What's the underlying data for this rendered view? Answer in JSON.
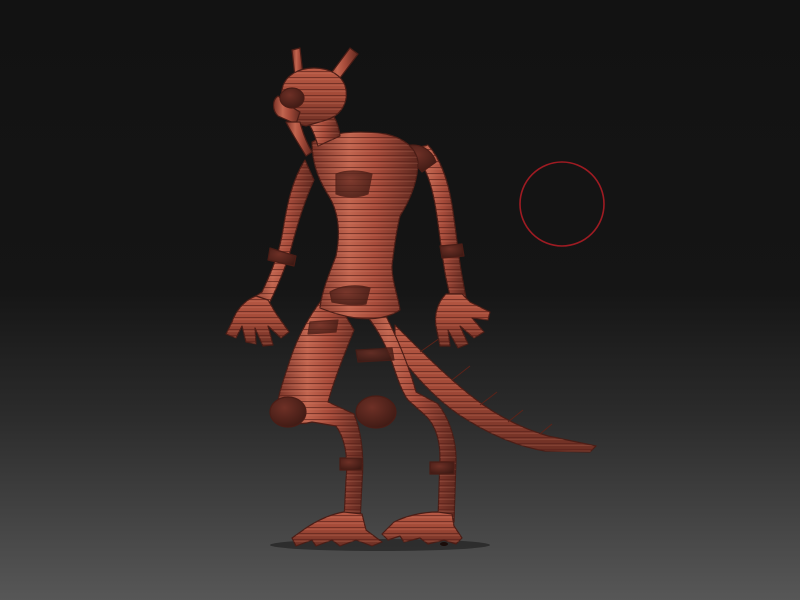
{
  "viewport": {
    "background_top": "#141414",
    "background_bottom": "#565656",
    "model_base_color": "#a84d3c",
    "model_highlight_color": "#cf7a63",
    "model_shadow_color": "#5f2a21",
    "model_band_color": "#6e3025",
    "cursor_ring_color": "#9e1b22"
  },
  "model": {
    "name_icon": "lizard-figure-sculpt"
  },
  "brush_cursor": {
    "icon": "draw-size-ring"
  }
}
